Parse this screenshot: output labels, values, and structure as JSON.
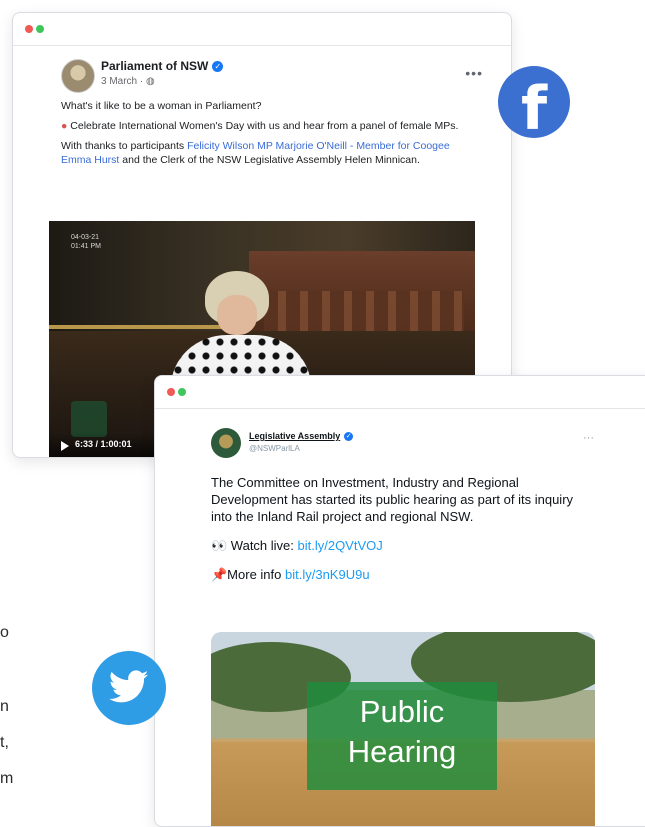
{
  "facebook_post": {
    "page_name": "Parliament of NSW",
    "date": "3 March",
    "more_label": "•••",
    "paragraph1": "What's it like to be a woman in Parliament?",
    "paragraph2": "Celebrate International Women's Day with us and hear from a panel of female MPs.",
    "thanks_prefix": "With thanks to participants ",
    "participants_link": "Felicity Wilson MP Marjorie O'Neill - Member for Coogee Emma Hurst",
    "thanks_suffix": " and the Clerk of the NSW Legislative Assembly Helen Minnican.",
    "video": {
      "timestamp_date": "04-03-21",
      "timestamp_time": "01:41 PM",
      "time_display": "6:33 / 1:00:01"
    }
  },
  "tweet": {
    "account_name": "Legislative Assembly",
    "handle": "@NSWParlLA",
    "more_label": "···",
    "body": "The Committee on Investment, Industry and Regional Development has started its public hearing as part of its inquiry into the Inland Rail project and regional NSW.",
    "watch_prefix": "👀 Watch live: ",
    "watch_link": "bit.ly/2QVtVOJ",
    "info_prefix": "📌More info ",
    "info_link": "bit.ly/3nK9U9u",
    "image_line1": "Public",
    "image_line2": "Hearing"
  },
  "logos": {
    "facebook": "f",
    "facebook_color": "#3b6fd0",
    "twitter_color": "#2f9ce6"
  },
  "background_text": [
    "o",
    "n",
    "t,",
    "m"
  ]
}
